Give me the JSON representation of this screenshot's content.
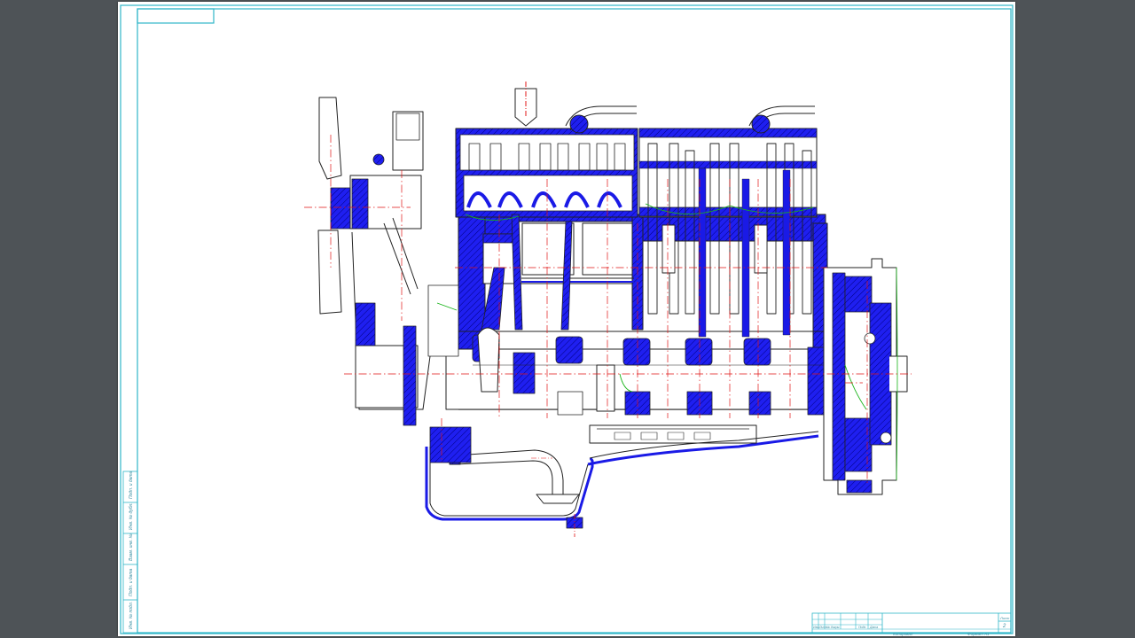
{
  "viewer": {
    "background": "#4e5357"
  },
  "colors": {
    "frame": "#2fb6c8",
    "hatch": "#1a1ae6",
    "outline": "#1f1f1f",
    "centerline": "#e01414",
    "aux_line": "#18b418"
  },
  "left_strip": {
    "columns": [
      "Инв. № подл.",
      "Подп. и дата",
      "Взам. инв. №",
      "Инв. № дубл.",
      "Подп. и дата"
    ]
  },
  "title_block": {
    "change_row": [
      "Изм.",
      "Лист",
      "№ докум.",
      "Подп.",
      "Дата"
    ],
    "sheet_label": "Лист",
    "sheet_number": "2",
    "copied": "Копировал",
    "format": "Формат   A1"
  }
}
